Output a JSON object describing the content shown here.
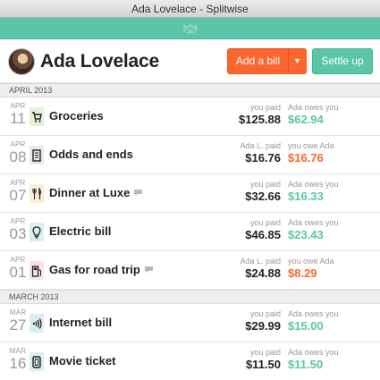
{
  "window": {
    "title": "Ada Lovelace - Splitwise"
  },
  "header": {
    "name": "Ada Lovelace",
    "add_bill_label": "Add a bill",
    "settle_up_label": "Settle up"
  },
  "colors": {
    "brand_green": "#5bc5a7",
    "owed_green": "#5bc5a7",
    "owe_orange": "#ff652f",
    "add_bill_orange": "#ff652f"
  },
  "sections": [
    {
      "title": "APRIL 2013",
      "items": [
        {
          "month": "APR",
          "day": "11",
          "icon": "cart-icon",
          "icon_bg": "#e3f2d6",
          "description": "Groceries",
          "comment": false,
          "paid_label": "you paid",
          "paid_amount": "$125.88",
          "owe_label": "Ada owes you",
          "owe_amount": "$62.94",
          "owe_direction": "owed"
        },
        {
          "month": "APR",
          "day": "08",
          "icon": "receipt-icon",
          "icon_bg": "#e9e9e9",
          "description": "Odds and ends",
          "comment": false,
          "paid_label": "Ada L. paid",
          "paid_amount": "$16.76",
          "owe_label": "you owe Ada",
          "owe_amount": "$16.76",
          "owe_direction": "owe"
        },
        {
          "month": "APR",
          "day": "07",
          "icon": "fork-knife-icon",
          "icon_bg": "#fbeed4",
          "description": "Dinner at Luxe",
          "comment": true,
          "paid_label": "you paid",
          "paid_amount": "$32.66",
          "owe_label": "Ada owes you",
          "owe_amount": "$16.33",
          "owe_direction": "owed"
        },
        {
          "month": "APR",
          "day": "03",
          "icon": "lightbulb-icon",
          "icon_bg": "#d9eef3",
          "description": "Electric bill",
          "comment": false,
          "paid_label": "you paid",
          "paid_amount": "$46.85",
          "owe_label": "Ada owes you",
          "owe_amount": "$23.43",
          "owe_direction": "owed"
        },
        {
          "month": "APR",
          "day": "01",
          "icon": "gas-pump-icon",
          "icon_bg": "#fbe1ea",
          "description": "Gas for road trip",
          "comment": true,
          "paid_label": "Ada L. paid",
          "paid_amount": "$24.88",
          "owe_label": "you owe Ada",
          "owe_amount": "$8.29",
          "owe_direction": "owe"
        }
      ]
    },
    {
      "title": "MARCH 2013",
      "items": [
        {
          "month": "MAR",
          "day": "27",
          "icon": "wifi-icon",
          "icon_bg": "#d9eef3",
          "description": "Internet bill",
          "comment": false,
          "paid_label": "you paid",
          "paid_amount": "$29.99",
          "owe_label": "Ada owes you",
          "owe_amount": "$15.00",
          "owe_direction": "owed"
        },
        {
          "month": "MAR",
          "day": "16",
          "icon": "ticket-icon",
          "icon_bg": "#d9eef3",
          "description": "Movie ticket",
          "comment": false,
          "paid_label": "you paid",
          "paid_amount": "$11.50",
          "owe_label": "Ada owes you",
          "owe_amount": "$11.50",
          "owe_direction": "owed"
        }
      ]
    }
  ]
}
